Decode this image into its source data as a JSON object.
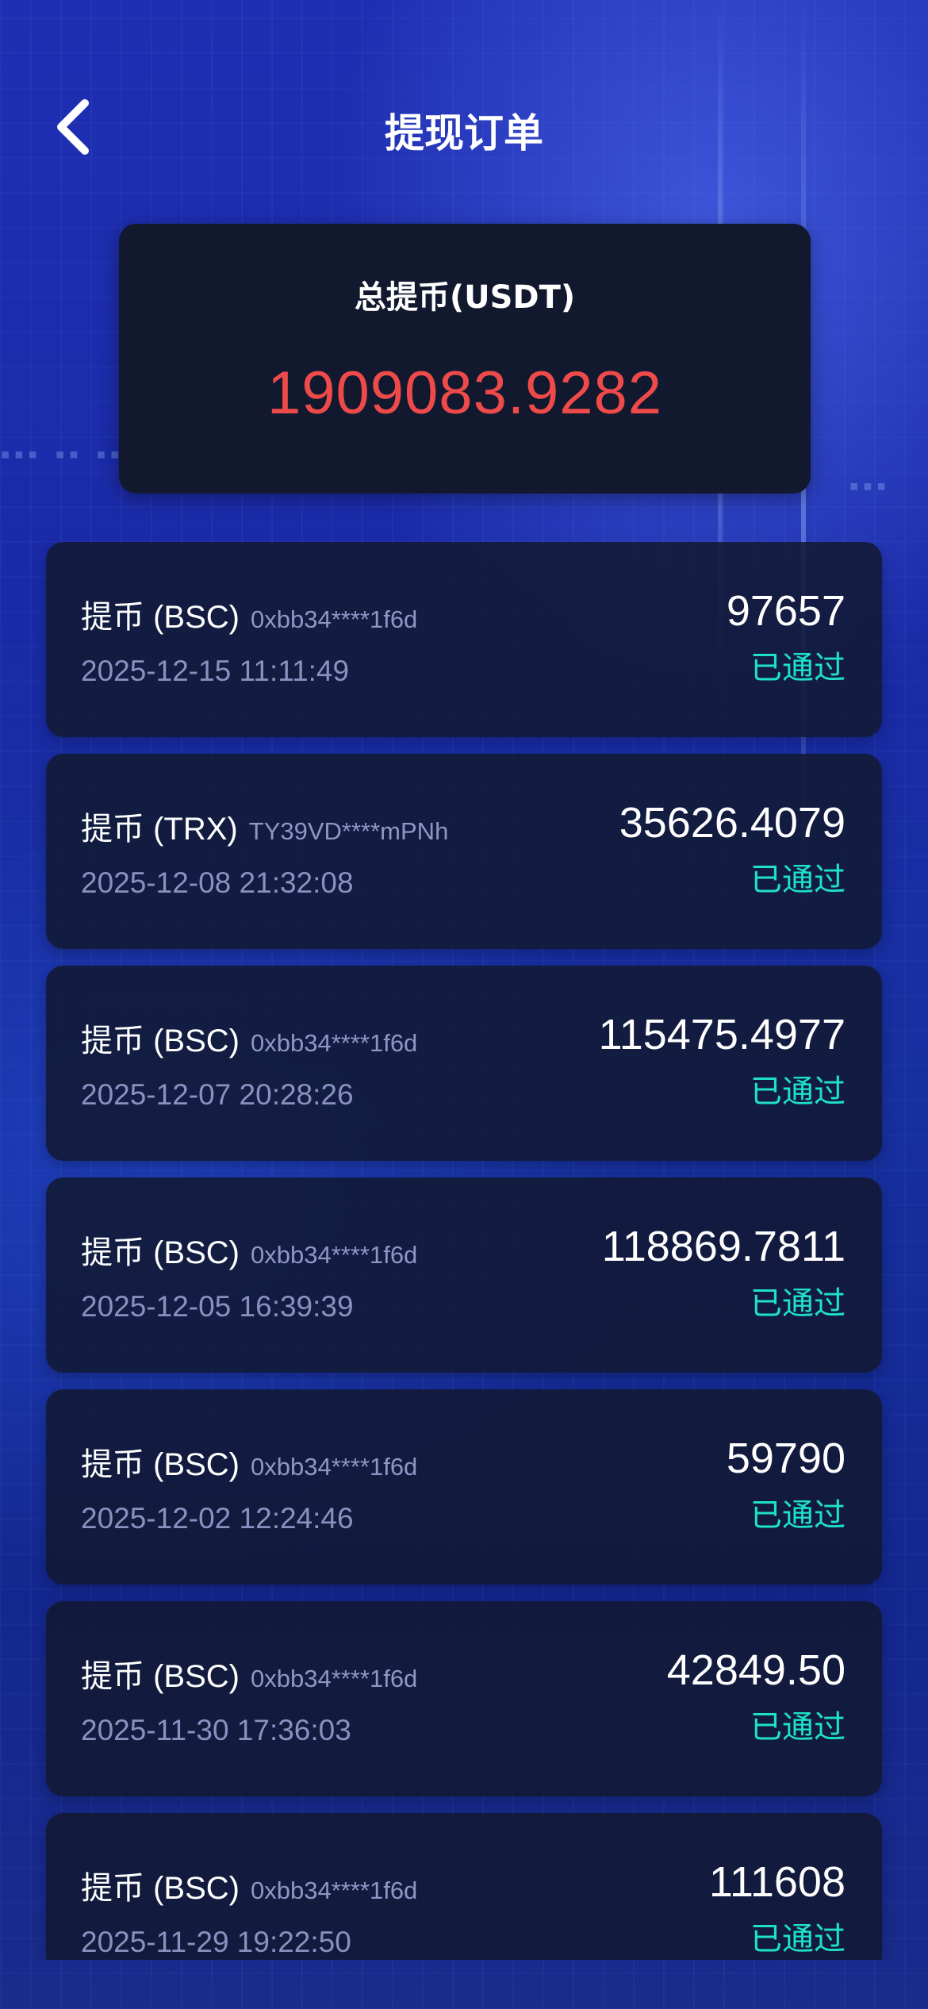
{
  "header": {
    "title": "提现订单",
    "back_icon": "chevron-left-icon"
  },
  "summary": {
    "label": "总提币(USDT)",
    "value": "1909083.9282",
    "value_color": "#ef4a4a"
  },
  "colors": {
    "accent_status": "#1fe0c8",
    "card_bg": "#12192e",
    "bg_blue": "#1f2fb3"
  },
  "orders": [
    {
      "type": "提币 (BSC)",
      "address": "0xbb34****1f6d",
      "time": "2025-12-15 11:11:49",
      "amount": "97657",
      "status": "已通过"
    },
    {
      "type": "提币 (TRX)",
      "address": "TY39VD****mPNh",
      "time": "2025-12-08 21:32:08",
      "amount": "35626.4079",
      "status": "已通过"
    },
    {
      "type": "提币 (BSC)",
      "address": "0xbb34****1f6d",
      "time": "2025-12-07 20:28:26",
      "amount": "115475.4977",
      "status": "已通过"
    },
    {
      "type": "提币 (BSC)",
      "address": "0xbb34****1f6d",
      "time": "2025-12-05 16:39:39",
      "amount": "118869.7811",
      "status": "已通过"
    },
    {
      "type": "提币 (BSC)",
      "address": "0xbb34****1f6d",
      "time": "2025-12-02 12:24:46",
      "amount": "59790",
      "status": "已通过"
    },
    {
      "type": "提币 (BSC)",
      "address": "0xbb34****1f6d",
      "time": "2025-11-30 17:36:03",
      "amount": "42849.50",
      "status": "已通过"
    },
    {
      "type": "提币 (BSC)",
      "address": "0xbb34****1f6d",
      "time": "2025-11-29 19:22:50",
      "amount": "111608",
      "status": "已通过"
    }
  ]
}
